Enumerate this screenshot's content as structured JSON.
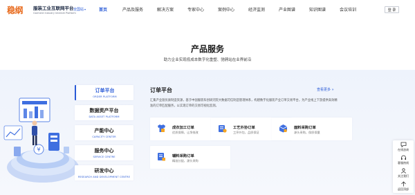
{
  "header": {
    "logo_mark": "稳纲",
    "logo_cn": "服装工业互联网平台",
    "logo_en": "Garment Industry Internet Platform",
    "region_label": "全国站",
    "login_label": "登 录",
    "nav": [
      {
        "label": "首页",
        "active": true
      },
      {
        "label": "产品及服务",
        "active": false
      },
      {
        "label": "解决方案",
        "active": false
      },
      {
        "label": "专家中心",
        "active": false
      },
      {
        "label": "案例中心",
        "active": false
      },
      {
        "label": "经济监测",
        "active": false
      },
      {
        "label": "产业图谱",
        "active": false
      },
      {
        "label": "知识图谱",
        "active": false
      },
      {
        "label": "会议培训",
        "active": false
      }
    ]
  },
  "section": {
    "title": "产品服务",
    "subtitle": "助力企业实现低成本数字化重塑、驰骋站在业界前沿"
  },
  "side_tabs": [
    {
      "cn": "订单平台",
      "en": "ORDER PLATFORM",
      "active": true
    },
    {
      "cn": "数据资产平台",
      "en": "DATA ASSET PLATFORM",
      "active": false
    },
    {
      "cn": "产能中心",
      "en": "CAPACITY CENTER",
      "active": false
    },
    {
      "cn": "服务中心",
      "en": "SERVICE CENTRE",
      "active": false
    },
    {
      "cn": "研发中心",
      "en": "RESEARCH AND DEVELOPMENT CENTRE",
      "active": false
    }
  ],
  "content": {
    "title": "订单平台",
    "more_label": "查看更多 »",
    "description": "汇集产业链优质制造资源，基于中国服装科创研究院大数据可信制造管理体系，构建数字化服装产业订单交易平台，为产业线上下游提供高效精准的订单匹配服务，以实现订单的交易可视化监测。"
  },
  "cards": [
    {
      "title": "成衣加工订单",
      "subtitle": "优质保障，让净效改",
      "icon": "garment-order-icon"
    },
    {
      "title": "工艺外协订单",
      "subtitle": "工序外包，品质保证",
      "icon": "process-outsource-icon"
    },
    {
      "title": "面料采购订单",
      "subtitle": "源头采购，保质保量",
      "icon": "fabric-purchase-icon"
    },
    {
      "title": "辅料采购订单",
      "subtitle": "精准分配，源头采购",
      "icon": "accessory-purchase-icon"
    }
  ],
  "float_bar": [
    {
      "label": "在线咨询",
      "icon": "chat-icon"
    },
    {
      "label": "客服热线",
      "icon": "headset-icon"
    },
    {
      "label": "关注我们",
      "icon": "user-icon"
    },
    {
      "label": "返回顶部",
      "icon": "arrow-up-icon"
    }
  ],
  "colors": {
    "accent": "#2a5bd7",
    "brand_orange": "#e86a1c",
    "panel_bg": "#eef3fc"
  }
}
